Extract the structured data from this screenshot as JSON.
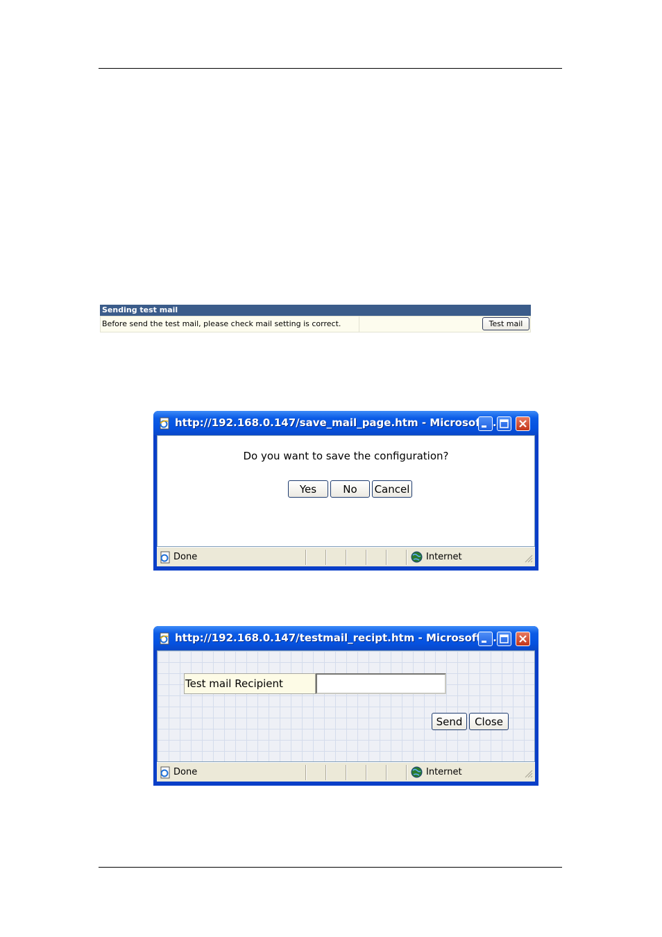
{
  "panel": {
    "header": "Sending test mail",
    "description": "Before send the test mail, please check mail setting is correct.",
    "button_label": "Test mail"
  },
  "save_dialog": {
    "title": "http://192.168.0.147/save_mail_page.htm - Microsoft ...",
    "question": "Do you want to save the configuration?",
    "buttons": {
      "yes": "Yes",
      "no": "No",
      "cancel": "Cancel"
    },
    "status": {
      "left": "Done",
      "zone": "Internet"
    }
  },
  "recipient_dialog": {
    "title": "http://192.168.0.147/testmail_recipt.htm - Microsoft I...",
    "field_label": "Test mail Recipient",
    "field_value": "",
    "buttons": {
      "send": "Send",
      "close": "Close"
    },
    "status": {
      "left": "Done",
      "zone": "Internet"
    }
  },
  "icons": {
    "window": "ie-page-icon",
    "status": "ie-page-icon",
    "zone": "globe-icon"
  },
  "colors": {
    "panel_header": "#3b5c8a",
    "titlebar": "#0c5ce6",
    "close_button": "#c2351a"
  }
}
